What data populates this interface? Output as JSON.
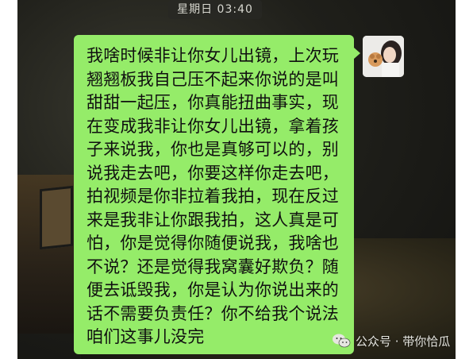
{
  "header": {
    "timestamp": "星期日 03:40"
  },
  "message": {
    "lines": [
      "我啥时候非让你女儿出镜，上次玩",
      "翘翘板我自己压不起来你说的是叫",
      "甜甜一起压，你真能扭曲事实，现",
      "在变成我非让你女儿出镜，拿着孩",
      "子来说我，你也是真够可以的，别",
      "说我走去吧，你要这样你走去吧，",
      "拍视频是你非拉着我拍，现在反过",
      "来是我非让你跟我拍，这人真是可",
      "怕，你是觉得你随便说我，我啥也",
      "不说？还是觉得我窝囊好欺负？随",
      "便去诋毁我，你是认为你说出来的",
      "话不需要负责任？你不给我个说法",
      "咱们这事儿没完"
    ],
    "bubble_color": "#95ec69"
  },
  "watermark": {
    "text": "公众号 · 带你恰瓜",
    "icon": "wechat-icon"
  }
}
